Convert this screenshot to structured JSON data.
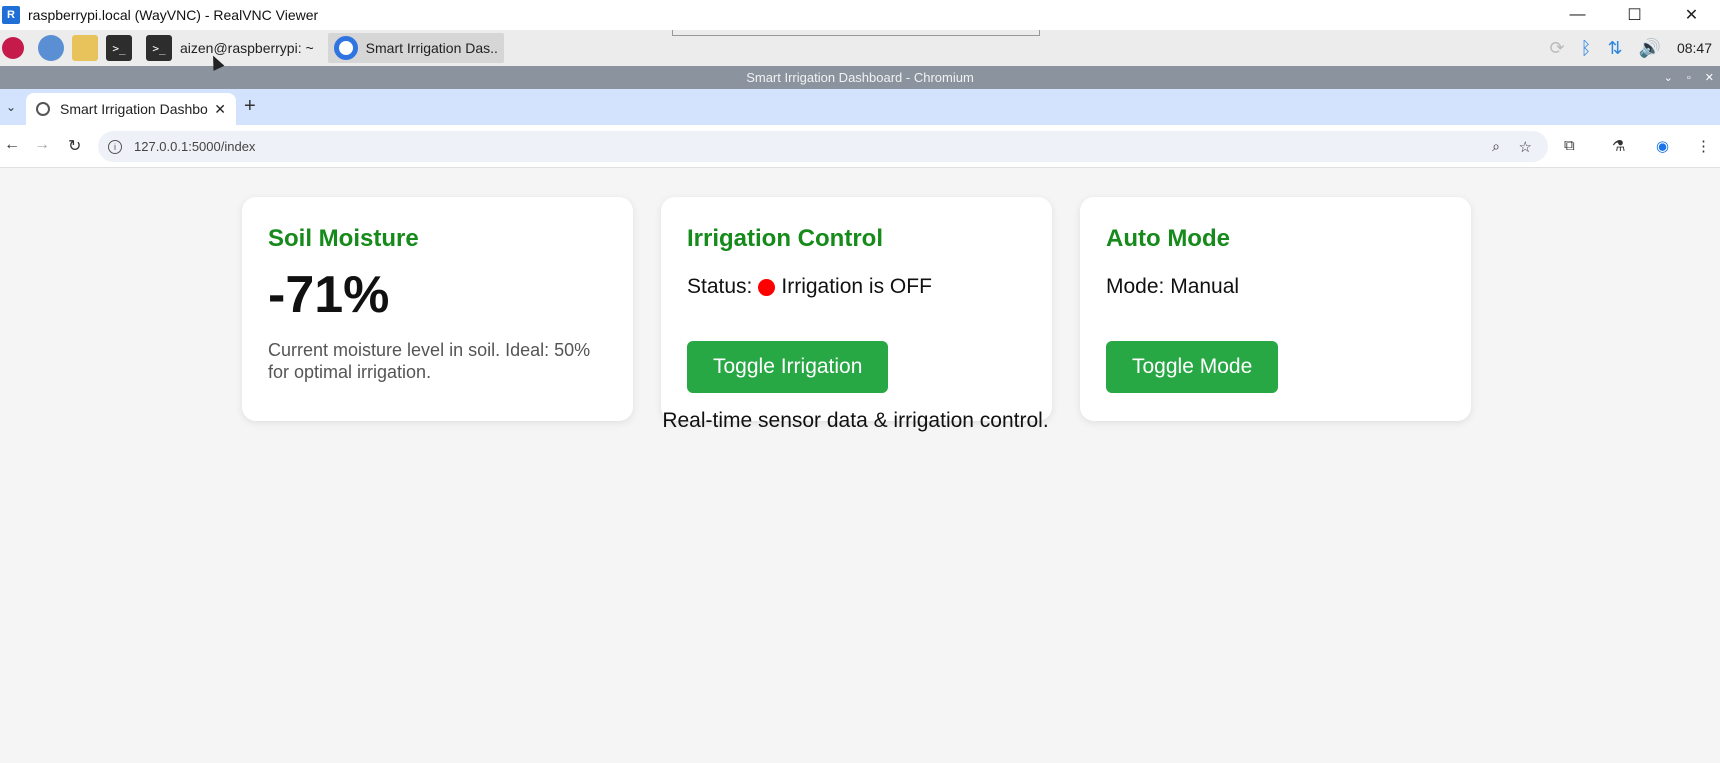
{
  "window": {
    "title": "raspberrypi.local (WayVNC) - RealVNC Viewer",
    "app_icon_letter": "R",
    "controls": [
      "—",
      "☐",
      "✕"
    ]
  },
  "taskbar": {
    "tasks": [
      {
        "label": "aizen@raspberrypi: ~"
      },
      {
        "label": "Smart Irrigation Das.."
      }
    ],
    "clock": "08:47"
  },
  "browser": {
    "window_title": "Smart Irrigation Dashboard - Chromium",
    "tab_title": "Smart Irrigation Dashbo",
    "url": "127.0.0.1:5000/index"
  },
  "dashboard": {
    "soil": {
      "title": "Soil Moisture",
      "value": "-71%",
      "description": "Current moisture level in soil. Ideal: 50% for optimal irrigation."
    },
    "irrigation": {
      "title": "Irrigation Control",
      "status_label": "Status:",
      "status_text": "Irrigation is OFF",
      "status_color": "#ff0000",
      "button": "Toggle Irrigation"
    },
    "auto": {
      "title": "Auto Mode",
      "mode_text": "Mode: Manual",
      "button": "Toggle Mode"
    },
    "footer": "Real-time sensor data & irrigation control."
  },
  "colors": {
    "heading_green": "#168a1a",
    "button_green": "#28a745",
    "tab_strip": "#d3e3fd"
  }
}
